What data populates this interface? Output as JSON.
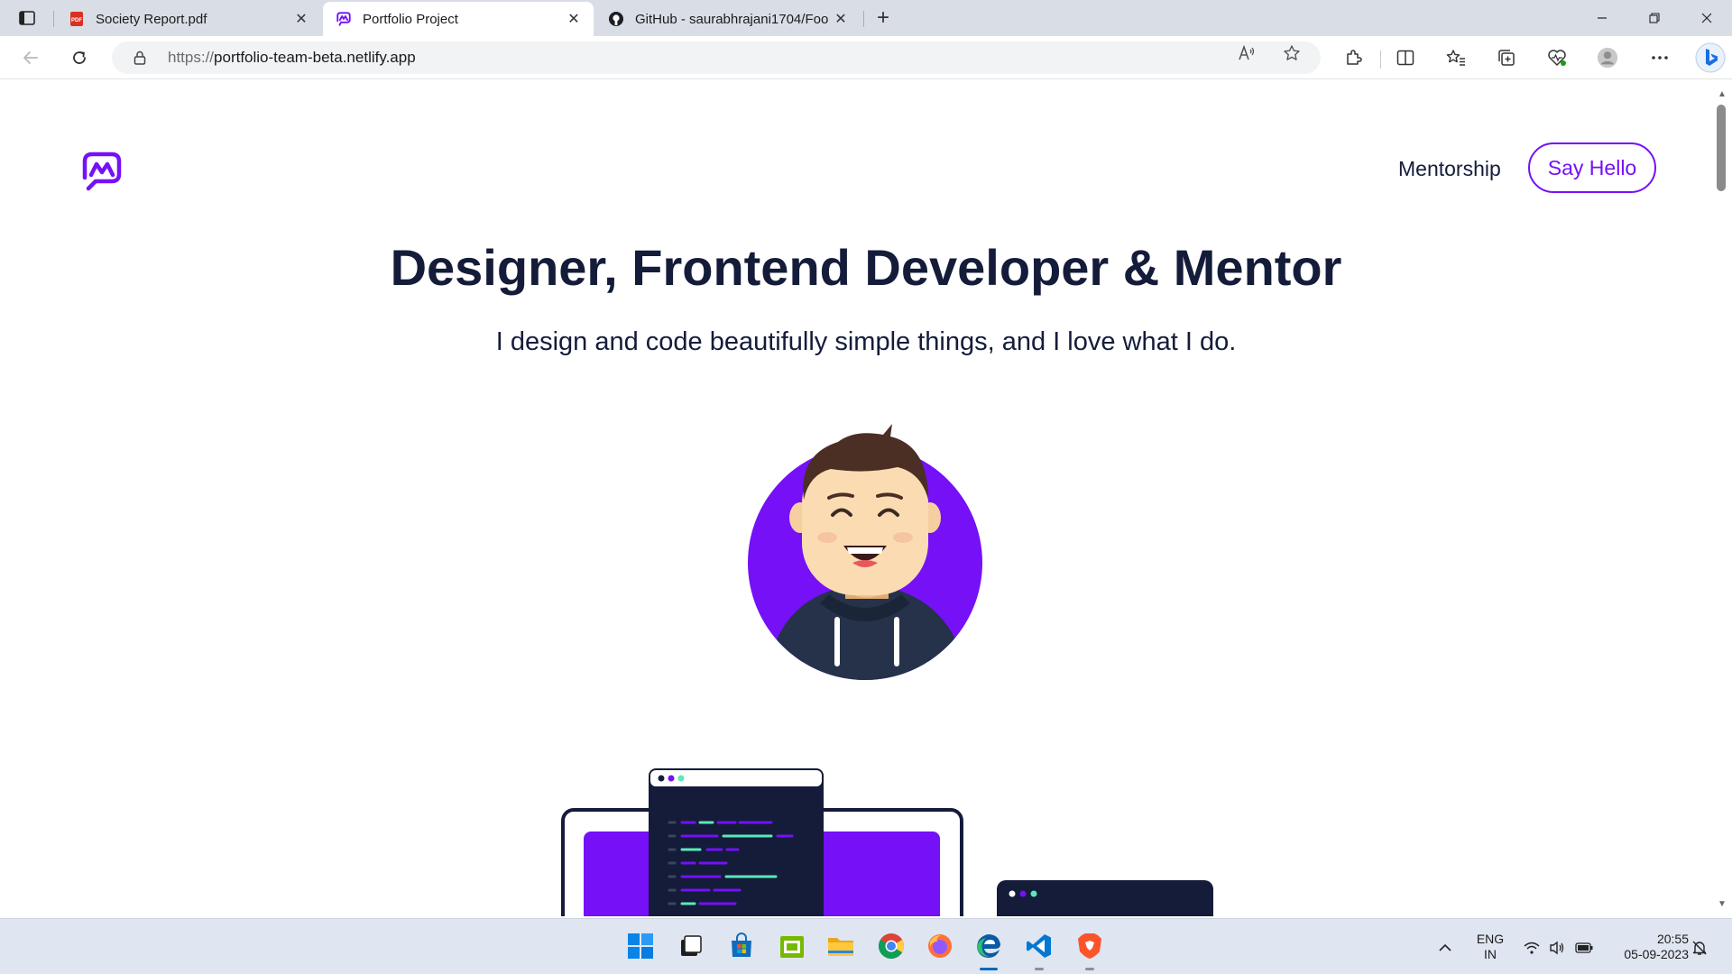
{
  "browser": {
    "tabs": [
      {
        "title": "Society Report.pdf",
        "favicon": "pdf-icon",
        "active": false
      },
      {
        "title": "Portfolio Project",
        "favicon": "portfolio-logo-icon",
        "active": true
      },
      {
        "title": "GitHub - saurabhrajani1704/Foo",
        "favicon": "github-icon",
        "active": false
      }
    ],
    "url_scheme": "https://",
    "url_host": "portfolio-team-beta.netlify.app"
  },
  "page": {
    "nav_link": "Mentorship",
    "cta": "Say Hello",
    "title": "Designer, Frontend Developer & Mentor",
    "subtitle": "I design and code beautifully simple things, and I love what I do.",
    "accent_color": "#7510f7",
    "text_color": "#141c3a"
  },
  "taskbar": {
    "language": "ENG",
    "region": "IN",
    "time": "20:55",
    "date": "05-09-2023"
  }
}
